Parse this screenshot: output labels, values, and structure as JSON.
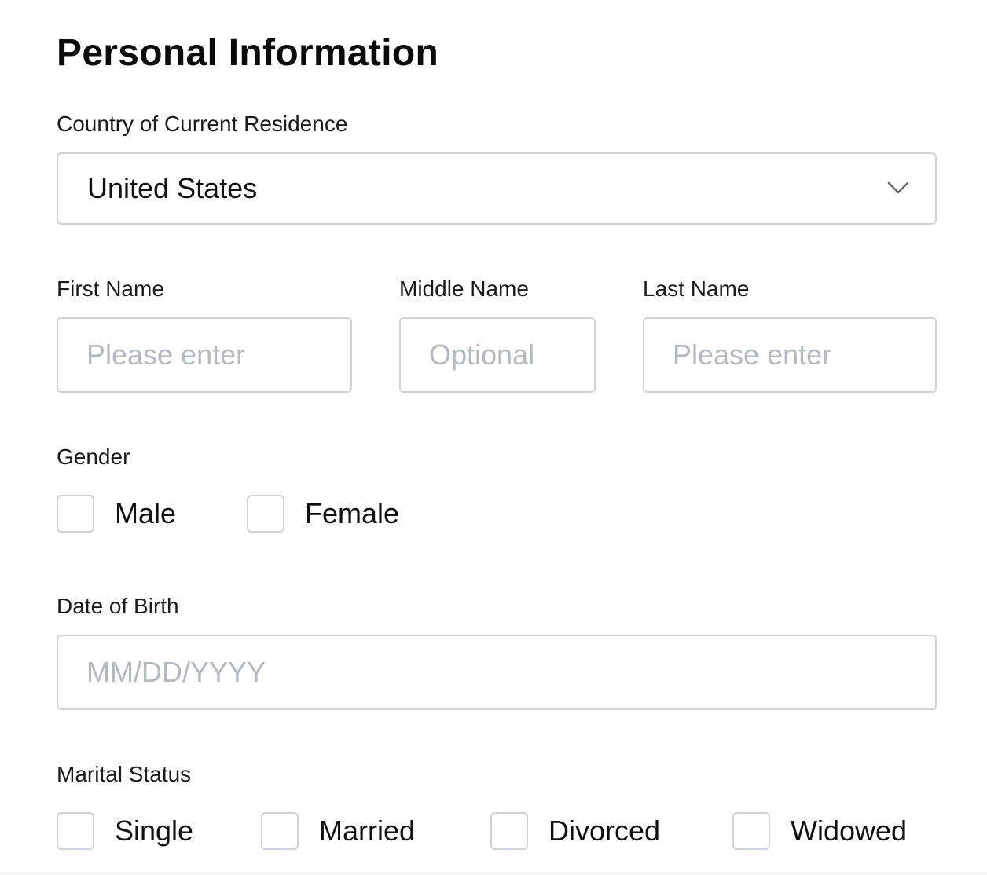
{
  "form": {
    "title": "Personal Information",
    "country": {
      "label": "Country of Current Residence",
      "value": "United States",
      "icon": "chevron-down-icon"
    },
    "first_name": {
      "label": "First Name",
      "placeholder": "Please enter",
      "value": ""
    },
    "middle_name": {
      "label": "Middle Name",
      "placeholder": "Optional",
      "value": ""
    },
    "last_name": {
      "label": "Last Name",
      "placeholder": "Please enter",
      "value": ""
    },
    "gender": {
      "label": "Gender",
      "options": [
        {
          "label": "Male",
          "checked": false
        },
        {
          "label": "Female",
          "checked": false
        }
      ]
    },
    "date_of_birth": {
      "label": "Date of Birth",
      "placeholder": "MM/DD/YYYY",
      "value": ""
    },
    "marital_status": {
      "label": "Marital Status",
      "options": [
        {
          "label": "Single",
          "checked": false
        },
        {
          "label": "Married",
          "checked": false
        },
        {
          "label": "Divorced",
          "checked": false
        },
        {
          "label": "Widowed",
          "checked": false
        }
      ]
    }
  },
  "colors": {
    "border": "#cfd2d6",
    "placeholder": "#b4b9c1",
    "text": "#111111"
  }
}
